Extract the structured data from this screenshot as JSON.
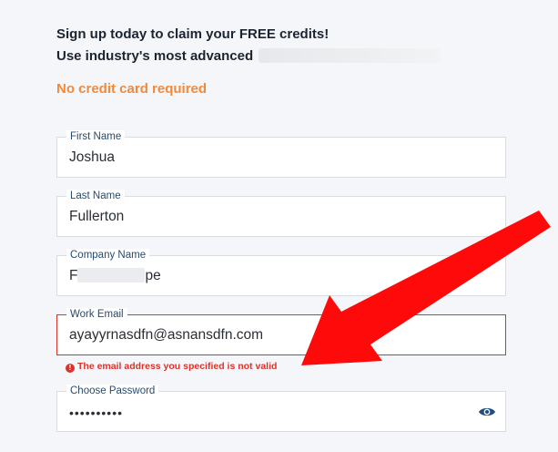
{
  "header": {
    "line1": "Sign up today to claim your FREE credits!",
    "line2": "Use industry's most advanced",
    "no_card": "No credit card required"
  },
  "form": {
    "first_name": {
      "label": "First Name",
      "value": "Joshua"
    },
    "last_name": {
      "label": "Last Name",
      "value": "Fullerton"
    },
    "company": {
      "label": "Company Name",
      "value_start": "F",
      "value_end": "ре"
    },
    "email": {
      "label": "Work Email",
      "value": "ayayyrnasdfn@asnansdfn.com",
      "error": "The email address you specified is not valid"
    },
    "password": {
      "label": "Choose Password",
      "value": "••••••••••"
    }
  },
  "colors": {
    "accent_orange": "#f28a3b",
    "error_red": "#d9342b",
    "label_blue": "#2a4a6b",
    "eye_icon": "#1f4f82"
  },
  "icons": {
    "error": "exclamation-circle-icon",
    "password_toggle": "eye-icon",
    "annotation": "red-arrow-icon"
  }
}
